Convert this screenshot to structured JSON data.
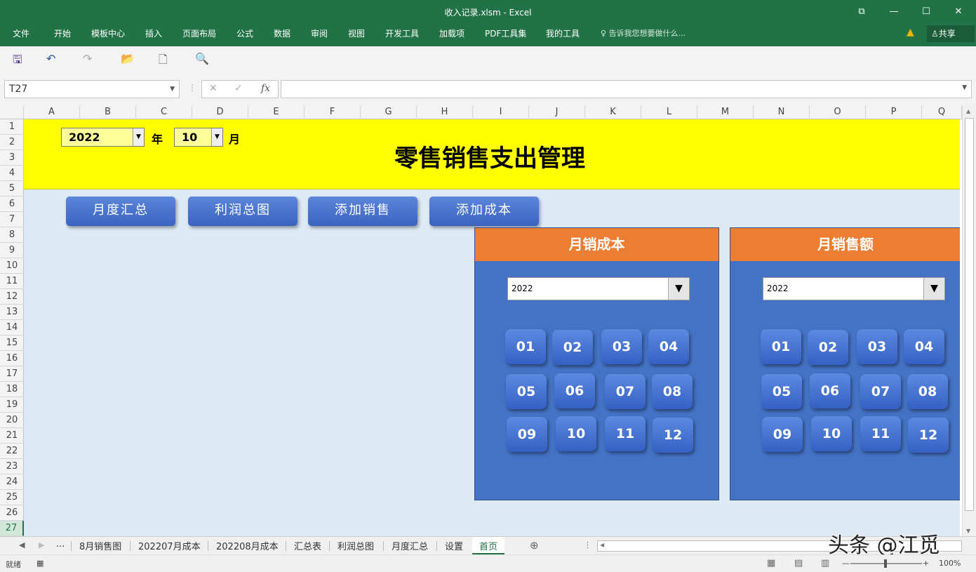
{
  "window": {
    "title": "收入记录.xlsm - Excel",
    "restore_icon": "⧉",
    "minimize_icon": "—",
    "maximize_icon": "☐",
    "close_icon": "✕"
  },
  "ribbon": {
    "tabs": [
      "文件",
      "开始",
      "模板中心",
      "插入",
      "页面布局",
      "公式",
      "数据",
      "审阅",
      "视图",
      "开发工具",
      "加载项",
      "PDF工具集",
      "我的工具"
    ],
    "tell_me": "告诉我您想要做什么...",
    "share": "共享"
  },
  "qat": {
    "save": "🖫",
    "undo": "↶",
    "redo": "↷",
    "open": "📂",
    "new": "🗋",
    "preview": "🔍"
  },
  "formula_bar": {
    "name_box": "T27",
    "formula": "",
    "fx": "fx",
    "cancel": "✕",
    "enter": "✓"
  },
  "columns": [
    "A",
    "B",
    "C",
    "D",
    "E",
    "F",
    "G",
    "H",
    "I",
    "J",
    "K",
    "L",
    "M",
    "N",
    "O",
    "P",
    "Q"
  ],
  "rows": [
    "1",
    "2",
    "3",
    "4",
    "5",
    "6",
    "7",
    "8",
    "9",
    "10",
    "11",
    "12",
    "13",
    "14",
    "15",
    "16",
    "17",
    "18",
    "19",
    "20",
    "21",
    "22",
    "23",
    "24",
    "25",
    "26",
    "27"
  ],
  "header": {
    "year_value": "2022",
    "year_unit": "年",
    "month_value": "10",
    "month_unit": "月",
    "title": "零售销售支出管理"
  },
  "nav_buttons": [
    "月度汇总",
    "利润总图",
    "添加销售",
    "添加成本"
  ],
  "panels": [
    {
      "title": "月销成本",
      "year": "2022",
      "months": [
        "01",
        "02",
        "03",
        "04",
        "05",
        "06",
        "07",
        "08",
        "09",
        "10",
        "11",
        "12"
      ]
    },
    {
      "title": "月销售额",
      "year": "2022",
      "months": [
        "01",
        "02",
        "03",
        "04",
        "05",
        "06",
        "07",
        "08",
        "09",
        "10",
        "11",
        "12"
      ]
    }
  ],
  "sheet_tabs": [
    "...",
    "8月销售图",
    "202207月成本",
    "202208月成本",
    "汇总表",
    "利润总图",
    "月度汇总",
    "设置",
    "首页"
  ],
  "active_sheet": "首页",
  "status": {
    "ready": "就绪",
    "zoom": "100%"
  },
  "watermark": "头条 @江觅"
}
